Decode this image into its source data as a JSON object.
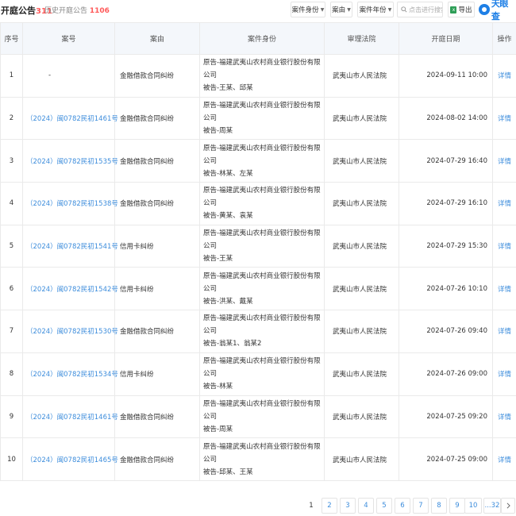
{
  "header": {
    "title": "开庭公告",
    "title_count": "311",
    "history_label": "历史开庭公告",
    "history_count": "1106",
    "filters": [
      "案件身份",
      "案由",
      "案件年份"
    ],
    "search_placeholder": "点击进行搜索",
    "export_label": "导出",
    "logo_text": "天眼查"
  },
  "table": {
    "columns": [
      "序号",
      "案号",
      "案由",
      "案件身份",
      "审理法院",
      "开庭日期",
      "操作"
    ],
    "rows": [
      {
        "no": "1",
        "case_no": "-",
        "cause": "金融借款合同纠纷",
        "plaintiff": "原告-福建武夷山农村商业银行股份有限公司",
        "defendant": "被告-王某、邱某",
        "court": "武夷山市人民法院",
        "date": "2024-09-11 10:00",
        "action": "详情"
      },
      {
        "no": "2",
        "case_no": "（2024）闽0782民初1461号",
        "cause": "金融借款合同纠纷",
        "plaintiff": "原告-福建武夷山农村商业银行股份有限公司",
        "defendant": "被告-周某",
        "court": "武夷山市人民法院",
        "date": "2024-08-02 14:00",
        "action": "详情"
      },
      {
        "no": "3",
        "case_no": "（2024）闽0782民初1535号",
        "cause": "金融借款合同纠纷",
        "plaintiff": "原告-福建武夷山农村商业银行股份有限公司",
        "defendant": "被告-林某、左某",
        "court": "武夷山市人民法院",
        "date": "2024-07-29 16:40",
        "action": "详情"
      },
      {
        "no": "4",
        "case_no": "（2024）闽0782民初1538号",
        "cause": "金融借款合同纠纷",
        "plaintiff": "原告-福建武夷山农村商业银行股份有限公司",
        "defendant": "被告-黄某、袁某",
        "court": "武夷山市人民法院",
        "date": "2024-07-29 16:10",
        "action": "详情"
      },
      {
        "no": "5",
        "case_no": "（2024）闽0782民初1541号",
        "cause": "信用卡纠纷",
        "plaintiff": "原告-福建武夷山农村商业银行股份有限公司",
        "defendant": "被告-王某",
        "court": "武夷山市人民法院",
        "date": "2024-07-29 15:30",
        "action": "详情"
      },
      {
        "no": "6",
        "case_no": "（2024）闽0782民初1542号",
        "cause": "信用卡纠纷",
        "plaintiff": "原告-福建武夷山农村商业银行股份有限公司",
        "defendant": "被告-洪某、戴某",
        "court": "武夷山市人民法院",
        "date": "2024-07-26 10:10",
        "action": "详情"
      },
      {
        "no": "7",
        "case_no": "（2024）闽0782民初1530号",
        "cause": "金融借款合同纠纷",
        "plaintiff": "原告-福建武夷山农村商业银行股份有限公司",
        "defendant": "被告-翁某1、翁某2",
        "court": "武夷山市人民法院",
        "date": "2024-07-26 09:40",
        "action": "详情"
      },
      {
        "no": "8",
        "case_no": "（2024）闽0782民初1534号",
        "cause": "信用卡纠纷",
        "plaintiff": "原告-福建武夷山农村商业银行股份有限公司",
        "defendant": "被告-林某",
        "court": "武夷山市人民法院",
        "date": "2024-07-26 09:00",
        "action": "详情"
      },
      {
        "no": "9",
        "case_no": "（2024）闽0782民初1461号",
        "cause": "金融借款合同纠纷",
        "plaintiff": "原告-福建武夷山农村商业银行股份有限公司",
        "defendant": "被告-周某",
        "court": "武夷山市人民法院",
        "date": "2024-07-25 09:20",
        "action": "详情"
      },
      {
        "no": "10",
        "case_no": "（2024）闽0782民初1465号",
        "cause": "金融借款合同纠纷",
        "plaintiff": "原告-福建武夷山农村商业银行股份有限公司",
        "defendant": "被告-邱某、王某",
        "court": "武夷山市人民法院",
        "date": "2024-07-25 09:00",
        "action": "详情"
      }
    ]
  },
  "pagination": {
    "pages": [
      "1",
      "2",
      "3",
      "4",
      "5",
      "6",
      "7",
      "8",
      "9",
      "10",
      "...32"
    ],
    "current": "1",
    "next_icon": "chevron-right-icon"
  }
}
